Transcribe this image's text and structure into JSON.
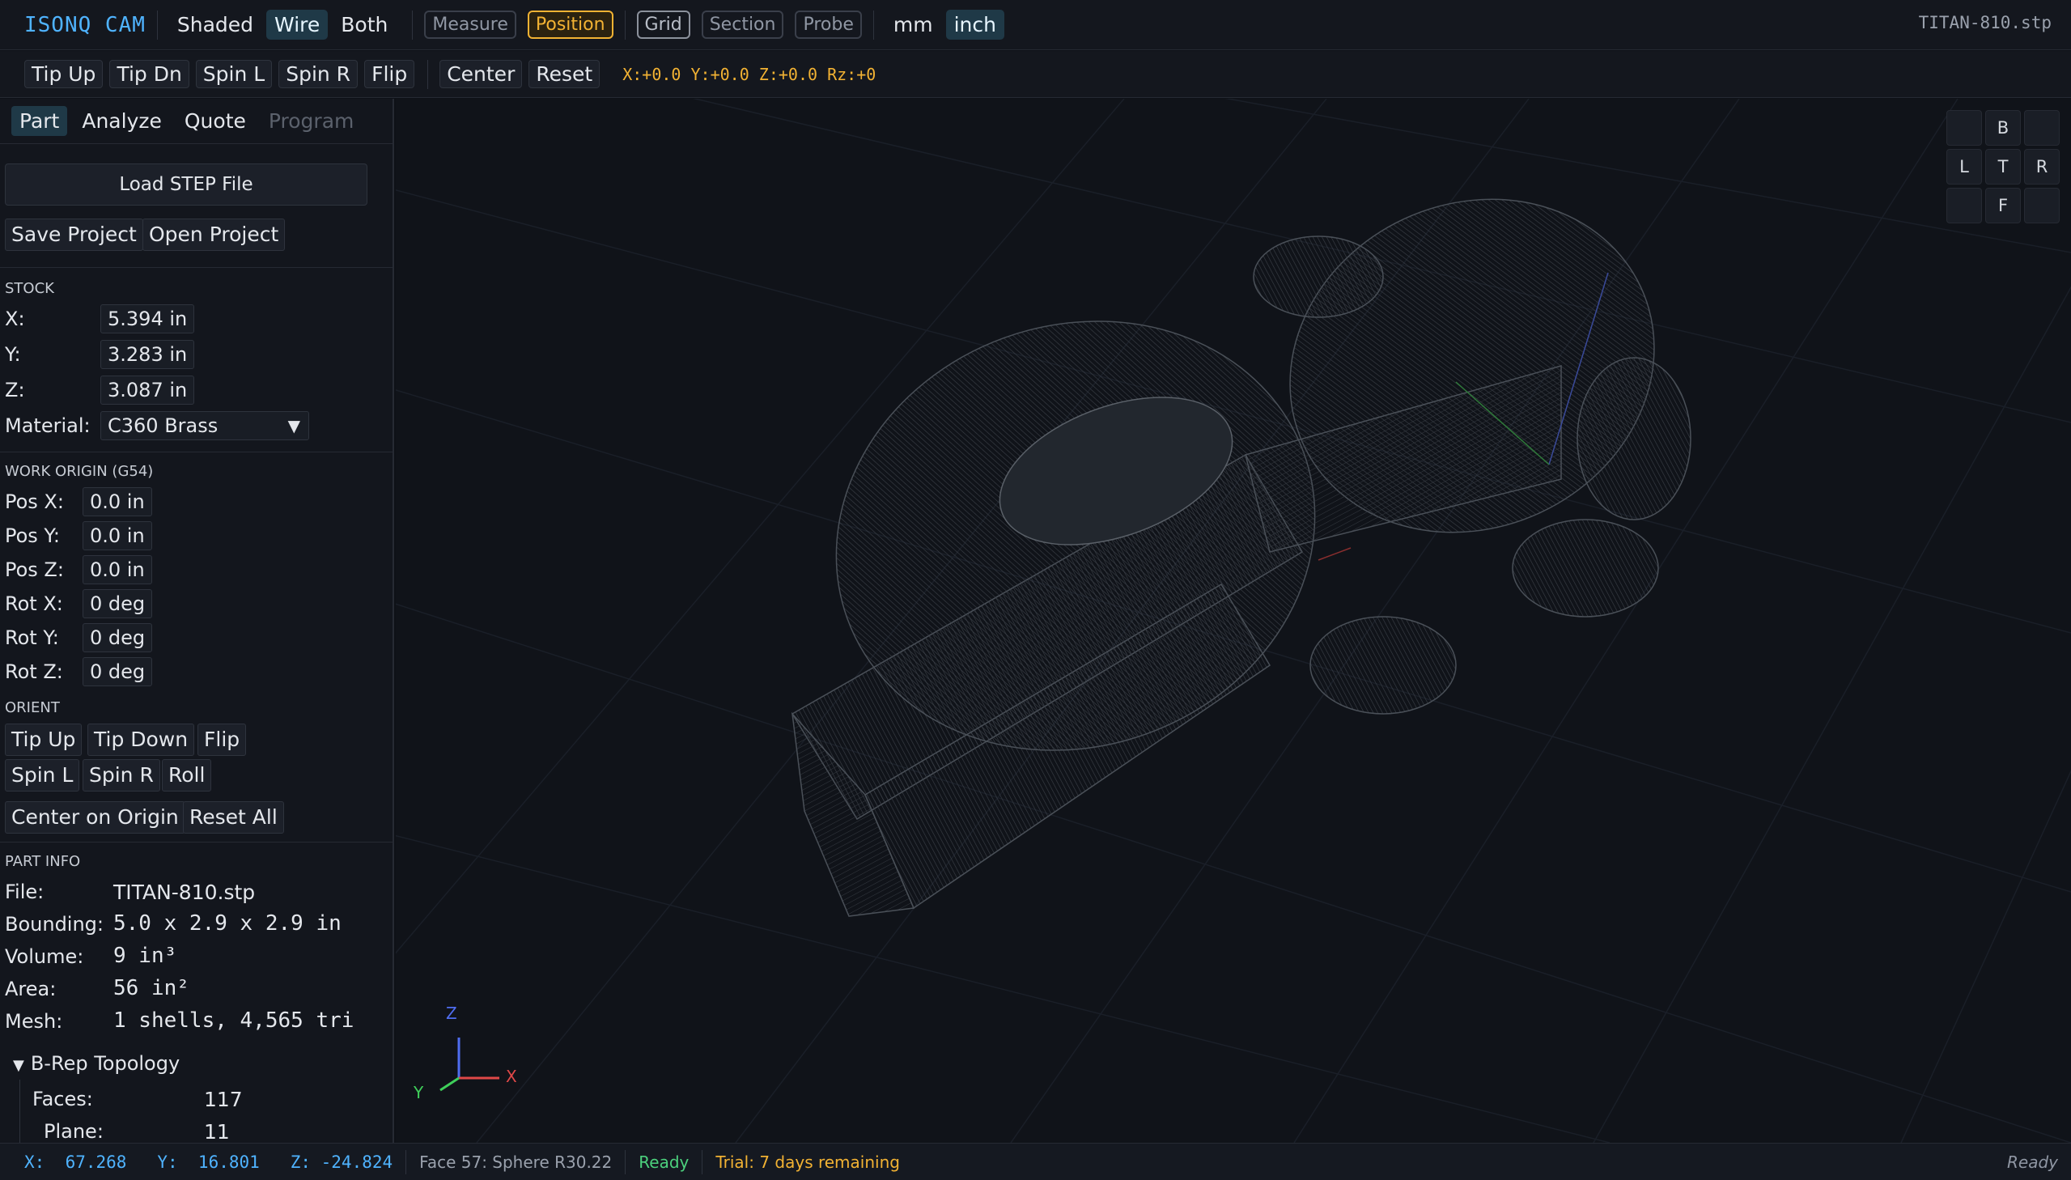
{
  "app": {
    "brand": "ISONQ CAM",
    "file_label": "TITAN-810.stp"
  },
  "topbar": {
    "render_modes": [
      "Shaded",
      "Wire",
      "Both"
    ],
    "active_render_mode": "Wire",
    "tools": [
      "Measure",
      "Position"
    ],
    "active_tool": "Position",
    "view_toggles": [
      "Grid",
      "Section",
      "Probe"
    ],
    "units": [
      "mm",
      "inch"
    ],
    "active_unit": "inch"
  },
  "toolbar2": {
    "orient_buttons": [
      "Tip Up",
      "Tip Dn",
      "Spin L",
      "Spin R",
      "Flip"
    ],
    "view_buttons": [
      "Center",
      "Reset"
    ],
    "readout": "X:+0.0 Y:+0.0 Z:+0.0 Rz:+0"
  },
  "sidebar": {
    "tabs": [
      "Part",
      "Analyze",
      "Quote",
      "Program"
    ],
    "active_tab": "Part",
    "load_step": "Load STEP File",
    "save_project": "Save Project",
    "open_project": "Open Project",
    "stock": {
      "title": "STOCK",
      "x_label": "X:",
      "x_value": "5.394 in",
      "y_label": "Y:",
      "y_value": "3.283 in",
      "z_label": "Z:",
      "z_value": "3.087 in",
      "material_label": "Material:",
      "material_value": "C360 Brass"
    },
    "work_origin": {
      "title": "WORK ORIGIN (G54)",
      "rows": [
        {
          "label": "Pos X:",
          "value": "0.0 in"
        },
        {
          "label": "Pos Y:",
          "value": "0.0 in"
        },
        {
          "label": "Pos Z:",
          "value": "0.0 in"
        },
        {
          "label": "Rot X:",
          "value": "0 deg"
        },
        {
          "label": "Rot Y:",
          "value": "0 deg"
        },
        {
          "label": "Rot Z:",
          "value": "0 deg"
        }
      ]
    },
    "orient": {
      "title": "ORIENT",
      "tip_up": "Tip Up",
      "tip_down": "Tip Down",
      "flip": "Flip",
      "spin_l": "Spin L",
      "spin_r": "Spin R",
      "roll": "Roll",
      "center_on_origin": "Center on Origin",
      "reset_all": "Reset All"
    },
    "part_info": {
      "title": "PART INFO",
      "file_label": "File:",
      "file_value": "TITAN-810.stp",
      "bounding_label": "Bounding:",
      "bounding_value": "5.0 x 2.9 x 2.9 in",
      "volume_label": "Volume:",
      "volume_value": "9 in³",
      "area_label": "Area:",
      "area_value": "56 in²",
      "mesh_label": "Mesh:",
      "mesh_value": "1 shells, 4,565 tri"
    },
    "brep": {
      "title": "B-Rep Topology",
      "faces_label": "Faces:",
      "faces_value": "117",
      "plane_label": "Plane:",
      "plane_value": "11"
    }
  },
  "viewcube": {
    "top": "B",
    "left": "L",
    "center": "T",
    "right": "R",
    "bottom": "F"
  },
  "axis_triad": {
    "x": "X",
    "y": "Y",
    "z": "Z"
  },
  "statusbar": {
    "coords": "X:  67.268   Y:  16.801   Z: -24.824",
    "face": "Face 57: Sphere R30.22",
    "ready": "Ready",
    "trial": "Trial: 7 days remaining",
    "right_status": "Ready"
  }
}
